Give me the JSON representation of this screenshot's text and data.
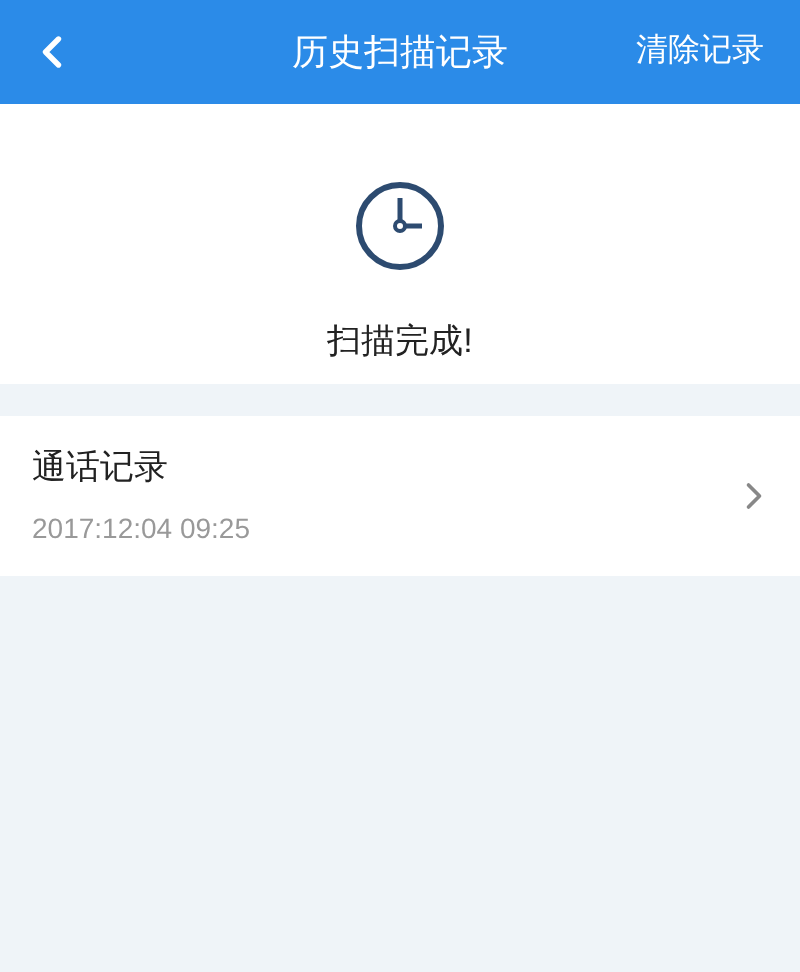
{
  "header": {
    "title": "历史扫描记录",
    "action": "清除记录"
  },
  "status": {
    "message": "扫描完成!"
  },
  "records": [
    {
      "title": "通话记录",
      "time": "2017:12:04 09:25"
    }
  ]
}
